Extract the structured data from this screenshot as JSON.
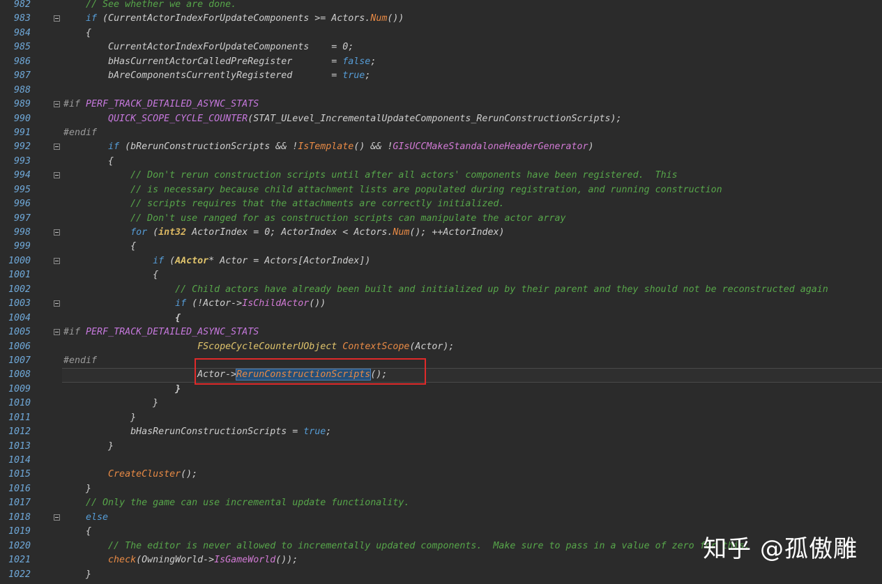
{
  "editor": {
    "lines": [
      {
        "n": "982",
        "fold": false,
        "html": "    <span class=\"cm\">// See whether we are done.</span>"
      },
      {
        "n": "983",
        "fold": true,
        "html": "    <span class=\"kw\">if</span> (CurrentActorIndexForUpdateComponents &gt;= Actors.<span class=\"fn\">Num</span>())"
      },
      {
        "n": "984",
        "fold": false,
        "html": "    {"
      },
      {
        "n": "985",
        "fold": false,
        "html": "        CurrentActorIndexForUpdateComponents    = 0;"
      },
      {
        "n": "986",
        "fold": false,
        "html": "        bHasCurrentActorCalledPreRegister       = <span class=\"kw\">false</span>;"
      },
      {
        "n": "987",
        "fold": false,
        "html": "        bAreComponentsCurrentlyRegistered       = <span class=\"kw\">true</span>;"
      },
      {
        "n": "988",
        "fold": false,
        "html": ""
      },
      {
        "n": "989",
        "fold": true,
        "html": "<span class=\"pp\">#if</span> <span class=\"mac\">PERF_TRACK_DETAILED_ASYNC_STATS</span>"
      },
      {
        "n": "990",
        "fold": false,
        "html": "        <span class=\"mac\">QUICK_SCOPE_CYCLE_COUNTER</span>(STAT_ULevel_IncrementalUpdateComponents_RerunConstructionScripts);"
      },
      {
        "n": "991",
        "fold": false,
        "html": "<span class=\"pp\">#endif</span>"
      },
      {
        "n": "992",
        "fold": true,
        "html": "        <span class=\"kw\">if</span> (bRerunConstructionScripts &amp;&amp; !<span class=\"fn\">IsTemplate</span>() &amp;&amp; !<span class=\"fnm\">GIsUCCMakeStandaloneHeaderGenerator</span>)"
      },
      {
        "n": "993",
        "fold": false,
        "html": "        {"
      },
      {
        "n": "994",
        "fold": true,
        "html": "            <span class=\"cm\">// Don't rerun construction scripts until after all actors' components have been registered.  This</span>"
      },
      {
        "n": "995",
        "fold": false,
        "html": "            <span class=\"cm\">// is necessary because child attachment lists are populated during registration, and running construction</span>"
      },
      {
        "n": "996",
        "fold": false,
        "html": "            <span class=\"cm\">// scripts requires that the attachments are correctly initialized.</span>"
      },
      {
        "n": "997",
        "fold": false,
        "html": "            <span class=\"cm\">// Don't use ranged for as construction scripts can manipulate the actor array</span>"
      },
      {
        "n": "998",
        "fold": true,
        "html": "            <span class=\"kw\">for</span> (<span class=\"kwb\">int32</span> ActorIndex = 0; ActorIndex &lt; Actors.<span class=\"fn\">Num</span>(); ++ActorIndex)"
      },
      {
        "n": "999",
        "fold": false,
        "html": "            {"
      },
      {
        "n": "1000",
        "fold": true,
        "html": "                <span class=\"kw\">if</span> (<span class=\"tp bold\">AActor</span>* Actor = Actors[ActorIndex])"
      },
      {
        "n": "1001",
        "fold": false,
        "html": "                {"
      },
      {
        "n": "1002",
        "fold": false,
        "html": "                    <span class=\"cm\">// Child actors have already been built and initialized up by their parent and they should not be reconstructed again</span>"
      },
      {
        "n": "1003",
        "fold": true,
        "html": "                    <span class=\"kw\">if</span> (!Actor-&gt;<span class=\"fnm\">IsChildActor</span>())"
      },
      {
        "n": "1004",
        "fold": false,
        "html": "                    <span class=\"bold\">{</span>"
      },
      {
        "n": "1005",
        "fold": true,
        "html": "<span class=\"pp\">#if</span> <span class=\"mac\">PERF_TRACK_DETAILED_ASYNC_STATS</span>"
      },
      {
        "n": "1006",
        "fold": false,
        "html": "                        <span class=\"tp\">FScopeCycleCounterUObject</span> <span class=\"fn\">ContextScope</span>(Actor);"
      },
      {
        "n": "1007",
        "fold": false,
        "html": "<span class=\"pp\">#endif</span>"
      },
      {
        "n": "1008",
        "fold": false,
        "current": true,
        "html": "                        Actor-&gt;<span class=\"fn sel\">RerunConstructionScripts</span>();"
      },
      {
        "n": "1009",
        "fold": false,
        "html": "                    <span class=\"bold\">}</span>"
      },
      {
        "n": "1010",
        "fold": false,
        "html": "                }"
      },
      {
        "n": "1011",
        "fold": false,
        "html": "            }"
      },
      {
        "n": "1012",
        "fold": false,
        "html": "            bHasRerunConstructionScripts = <span class=\"kw\">true</span>;"
      },
      {
        "n": "1013",
        "fold": false,
        "html": "        }"
      },
      {
        "n": "1014",
        "fold": false,
        "html": ""
      },
      {
        "n": "1015",
        "fold": false,
        "html": "        <span class=\"fn\">CreateCluster</span>();"
      },
      {
        "n": "1016",
        "fold": false,
        "html": "    }"
      },
      {
        "n": "1017",
        "fold": false,
        "html": "    <span class=\"cm\">// Only the game can use incremental update functionality.</span>"
      },
      {
        "n": "1018",
        "fold": true,
        "html": "    <span class=\"kw\">else</span>"
      },
      {
        "n": "1019",
        "fold": false,
        "html": "    {"
      },
      {
        "n": "1020",
        "fold": false,
        "html": "        <span class=\"cm\">// The editor is never allowed to incrementally updated components.  Make sure to pass in a value of zero for this.</span>"
      },
      {
        "n": "1021",
        "fold": false,
        "html": "        <span class=\"fn\">check</span>(OwningWorld-&gt;<span class=\"fnm\">IsGameWorld</span>());"
      },
      {
        "n": "1022",
        "fold": false,
        "html": "    }"
      }
    ]
  },
  "watermark": "知乎 @孤傲雕"
}
